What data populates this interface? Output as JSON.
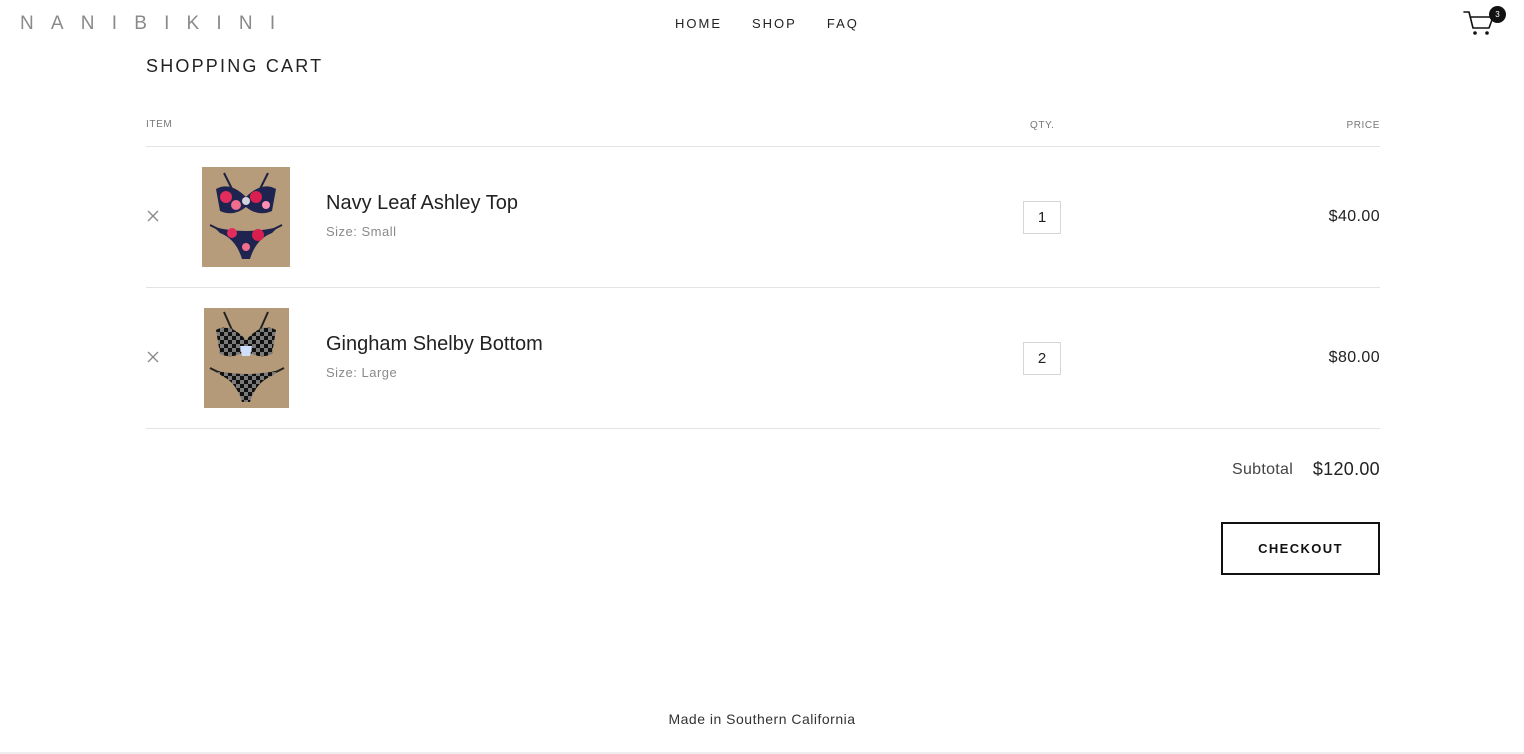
{
  "header": {
    "logo": "NANIBIKINI",
    "nav": [
      {
        "label": "HOME"
      },
      {
        "label": "SHOP"
      },
      {
        "label": "FAQ"
      }
    ],
    "cart_count": "3",
    "cart_icon": "shopping-cart-icon"
  },
  "main": {
    "title": "SHOPPING CART",
    "columns": {
      "item": "ITEM",
      "qty": "QTY.",
      "price": "PRICE"
    },
    "items": [
      {
        "name": "Navy Leaf Ashley Top",
        "size": "Size: Small",
        "quantity": "1",
        "price": "$40.00",
        "remove_icon": "close-icon"
      },
      {
        "name": "Gingham Shelby Bottom",
        "size": "Size: Large",
        "quantity": "2",
        "price": "$80.00",
        "remove_icon": "close-icon"
      }
    ],
    "subtotal_label": "Subtotal",
    "subtotal_value": "$120.00",
    "checkout_label": "CHECKOUT"
  },
  "footer": {
    "text": "Made in Southern California"
  },
  "colors": {
    "text": "#222222",
    "muted": "#8a8a8a",
    "border": "#e3e3e3",
    "button_border": "#111111"
  }
}
